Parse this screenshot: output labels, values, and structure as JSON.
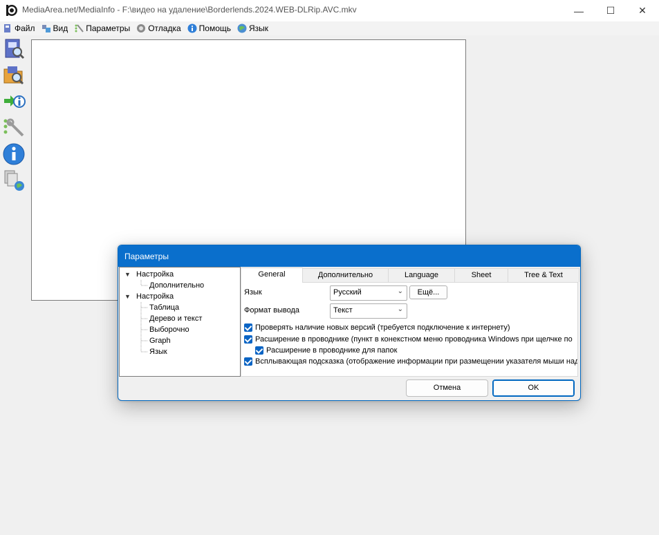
{
  "window": {
    "title": "MediaArea.net/MediaInfo - F:\\видео на удаление\\Borderlends.2024.WEB-DLRip.AVC.mkv",
    "minimize_glyph": "—",
    "maximize_glyph": "☐",
    "close_glyph": "✕"
  },
  "menu": [
    {
      "label": "Файл",
      "icon": "file-icon"
    },
    {
      "label": "Вид",
      "icon": "view-icon"
    },
    {
      "label": "Параметры",
      "icon": "options-icon"
    },
    {
      "label": "Отладка",
      "icon": "debug-icon"
    },
    {
      "label": "Помощь",
      "icon": "help-icon"
    },
    {
      "label": "Язык",
      "icon": "language-icon"
    }
  ],
  "toolbar": [
    "open-file-icon",
    "open-folder-icon",
    "export-icon",
    "preferences-icon",
    "about-icon",
    "web-icon"
  ],
  "dialog": {
    "title": "Параметры",
    "tree": [
      {
        "label": "Настройка",
        "expanded": true,
        "children": [
          "Дополнительно"
        ]
      },
      {
        "label": "Настройка",
        "expanded": true,
        "children": [
          "Таблица",
          "Дерево и текст",
          "Выборочно",
          "Graph",
          "Язык"
        ]
      }
    ],
    "tabs": [
      "General",
      "Дополнительно",
      "Language",
      "Sheet",
      "Tree & Text"
    ],
    "active_tab": "General",
    "general": {
      "language_label": "Язык",
      "language_value": "Русский",
      "more_button": "Ещё...",
      "output_label": "Формат вывода",
      "output_value": "Текст",
      "checkboxes": [
        {
          "label": "Проверять наличие новых версий (требуется подключение к интернету)",
          "checked": true
        },
        {
          "label": "Расширение в проводнике (пункт в конекстном меню проводника Windows при щелчке по",
          "checked": true
        },
        {
          "label": "Расширение в проводнике для папок",
          "checked": true
        },
        {
          "label": "Всплывающая подсказка (отображение информации при размещении указателя мыши над",
          "checked": true
        }
      ]
    },
    "cancel_button": "Отмена",
    "ok_button": "OK"
  }
}
